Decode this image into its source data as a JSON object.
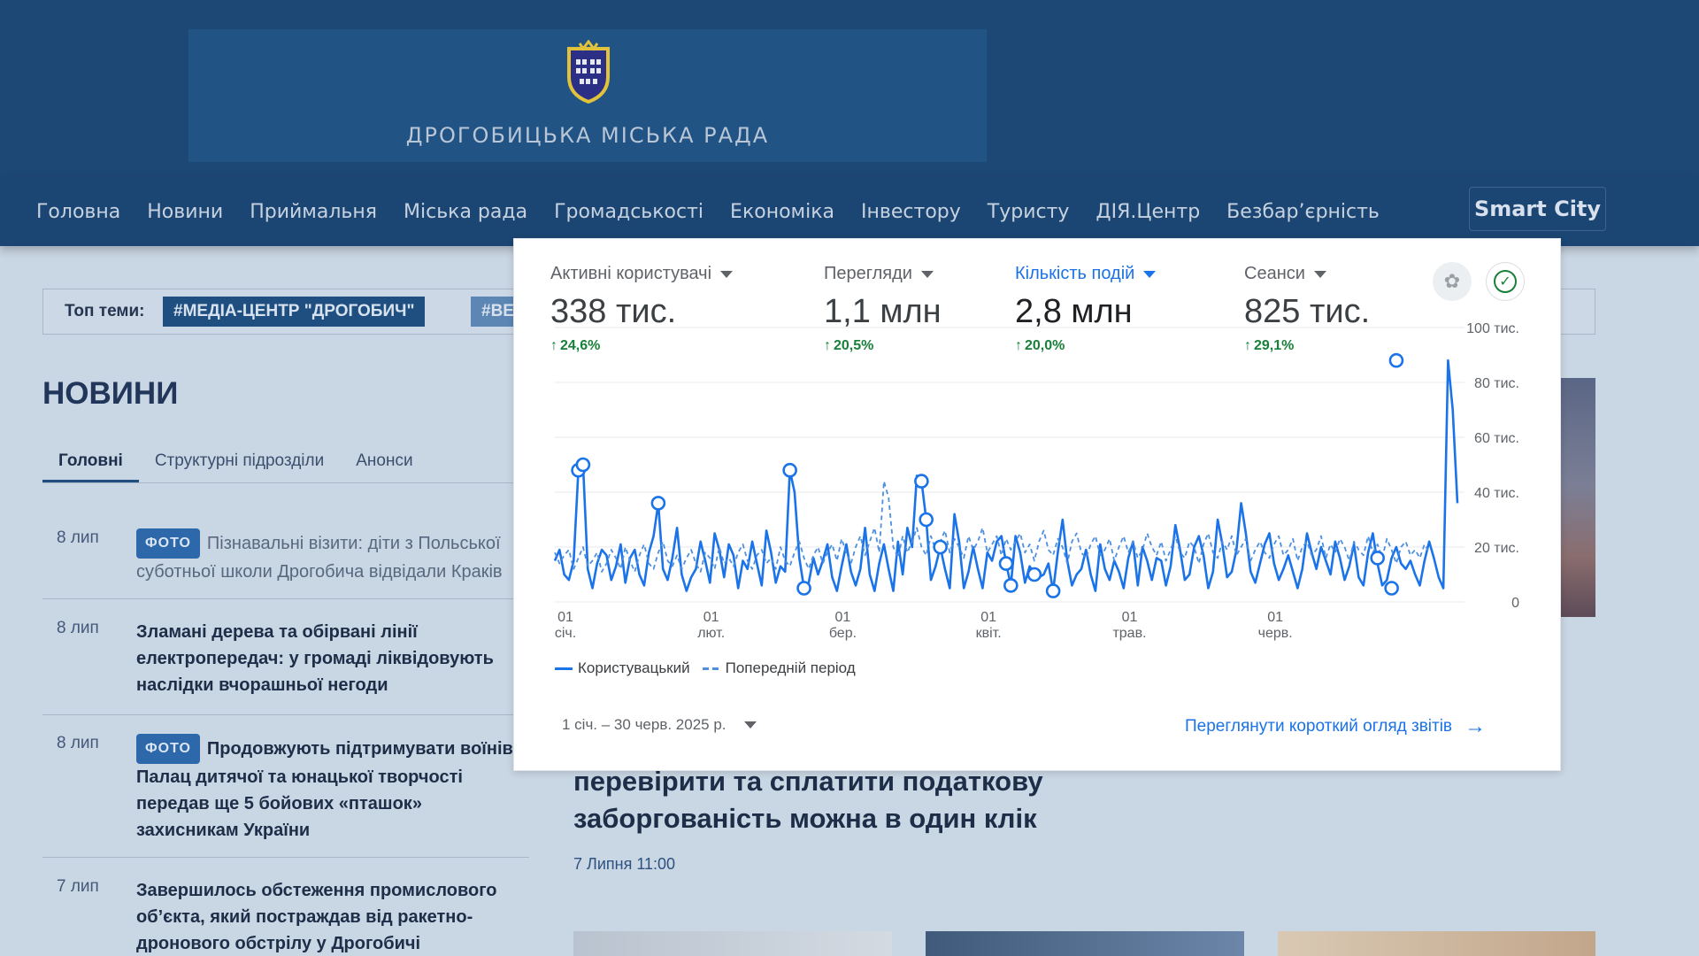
{
  "site": {
    "name": "ДРОГОБИЦЬКА МІСЬКА РАДА",
    "colors": {
      "header": "#1d4876",
      "nav": "#1b4572",
      "accent": "#1f4f80"
    }
  },
  "nav": {
    "items": [
      "Головна",
      "Новини",
      "Приймальня",
      "Міська рада",
      "Громадськості",
      "Економіка",
      "Інвестору",
      "Туристу",
      "ДІЯ.Центр",
      "Безбар’єрність"
    ],
    "smart_city": "Smart City"
  },
  "topics": {
    "label": "Топ теми:",
    "tags": [
      "#МЕДІА-ЦЕНТР \"ДРОГОБИЧ\"",
      "#ВЕ"
    ]
  },
  "news": {
    "title": "НОВИНИ",
    "tabs": [
      "Головні",
      "Структурні підрозділи",
      "Анонси"
    ],
    "badge": "ФОТО",
    "items": [
      {
        "date": "8 лип",
        "badge": "ФОТО",
        "text": "Пізнавальні візити: діти з Польської суботньої школи Дрогобича відвідали Краків"
      },
      {
        "date": "8 лип",
        "badge": "",
        "text": "Зламані дерева та обірвані лінії електропередач: у громаді ліквідовують наслідки вчорашньої негоди"
      },
      {
        "date": "8 лип",
        "badge": "ФОТО",
        "text": "Продовжують підтримувати воїнів: Палац дитячої та юнацької творчості передав ще 5 бойових «пташок» захисникам України"
      },
      {
        "date": "7 лип",
        "badge": "",
        "text": "Завершилось обстеження промислового об’єкта, який постраждав від ракетно-дронового обстрілу у Дрогобичі"
      }
    ],
    "hero": {
      "title": "перевірити та сплатити податкову заборгованість можна в один клік",
      "date": "7 Липня 11:00"
    }
  },
  "analytics": {
    "metrics": [
      {
        "label": "Активні користувачі",
        "value": "338 тис.",
        "delta": "24,6%",
        "active": false
      },
      {
        "label": "Перегляди",
        "value": "1,1 млн",
        "delta": "20,5%",
        "active": false
      },
      {
        "label": "Кількість подій",
        "value": "2,8 млн",
        "delta": "20,0%",
        "active": true
      },
      {
        "label": "Сеанси",
        "value": "825 тис.",
        "delta": "29,1%",
        "active": false
      }
    ],
    "icons": {
      "badge": "award-icon",
      "check": "check-circle-icon"
    },
    "legend": {
      "current": "Користувацький",
      "previous": "Попередній період"
    },
    "date_range": "1 січ. – 30 черв. 2025 р.",
    "report_link": "Переглянути короткий огляд звітів",
    "colors": {
      "current": "#1a73e8",
      "previous": "#4e8fe0",
      "positive": "#188038"
    }
  },
  "chart_data": {
    "type": "line",
    "x_ticks": [
      {
        "day": "01",
        "month": "січ."
      },
      {
        "day": "01",
        "month": "лют."
      },
      {
        "day": "01",
        "month": "бер."
      },
      {
        "day": "01",
        "month": "квіт."
      },
      {
        "day": "01",
        "month": "трав."
      },
      {
        "day": "01",
        "month": "черв."
      }
    ],
    "y_ticks": [
      "100 тис.",
      "80 тис.",
      "60 тис.",
      "40 тис.",
      "20 тис.",
      "0"
    ],
    "ylim": [
      0,
      100000
    ],
    "grid": true,
    "legend_position": "bottom-left",
    "series": [
      {
        "name": "Користувацький",
        "style": "solid",
        "values": [
          15000,
          19000,
          10000,
          8000,
          15000,
          48000,
          50000,
          12000,
          5000,
          14000,
          19000,
          17000,
          8000,
          13000,
          21000,
          7000,
          16000,
          19000,
          10000,
          6000,
          18000,
          24000,
          36000,
          12000,
          8000,
          16000,
          27000,
          10000,
          4000,
          9000,
          12000,
          22000,
          15000,
          7000,
          25000,
          19000,
          9000,
          21000,
          17000,
          5000,
          15000,
          12000,
          22000,
          14000,
          6000,
          26000,
          18000,
          7000,
          13000,
          11000,
          48000,
          40000,
          16000,
          5000,
          7000,
          16000,
          10000,
          15000,
          21000,
          9000,
          4000,
          13000,
          21000,
          11000,
          6000,
          12000,
          27000,
          10000,
          4000,
          14000,
          21000,
          12000,
          4000,
          22000,
          10000,
          27000,
          20000,
          46000,
          44000,
          30000,
          8000,
          13000,
          20000,
          12000,
          5000,
          32000,
          22000,
          5000,
          11000,
          20000,
          12000,
          5000,
          18000,
          15000,
          22000,
          24000,
          14000,
          6000,
          24000,
          18000,
          7000,
          13000,
          10000,
          9000,
          10000,
          14000,
          4000,
          18000,
          30000,
          15000,
          6000,
          10000,
          12000,
          19000,
          10000,
          4000,
          21000,
          12000,
          8000,
          15000,
          11000,
          5000,
          16000,
          22000,
          6000,
          20000,
          15000,
          8000,
          16000,
          15000,
          6000,
          13000,
          28000,
          19000,
          8000,
          10000,
          20000,
          24000,
          17000,
          5000,
          11000,
          30000,
          21000,
          9000,
          11000,
          19000,
          36000,
          25000,
          11000,
          7000,
          14000,
          21000,
          25000,
          14000,
          8000,
          12000,
          17000,
          11000,
          5000,
          12000,
          25000,
          18000,
          12000,
          20000,
          15000,
          10000,
          22000,
          16000,
          8000,
          13000,
          21000,
          9000,
          6000,
          18000,
          25000,
          14000,
          6000,
          8000,
          16000,
          20000,
          14000,
          12000,
          15000,
          10000,
          6000,
          15000,
          22000,
          16000,
          9000,
          5000,
          88000,
          70000,
          36000
        ]
      },
      {
        "name": "Попередній період",
        "style": "dashed",
        "values": [
          18000,
          14000,
          17000,
          19000,
          12000,
          16000,
          20000,
          13000,
          15000,
          18000,
          11000,
          14000,
          19000,
          16000,
          12000,
          20000,
          15000,
          11000,
          17000,
          21000,
          14000,
          12000,
          18000,
          22000,
          15000,
          13000,
          17000,
          12000,
          16000,
          19000,
          14000,
          11000,
          18000,
          16000,
          12000,
          20000,
          14000,
          16000,
          13000,
          18000,
          21000,
          15000,
          12000,
          17000,
          19000,
          14000,
          16000,
          12000,
          20000,
          15000,
          13000,
          18000,
          22000,
          16000,
          12000,
          17000,
          20000,
          14000,
          18000,
          21000,
          15000,
          23000,
          18000,
          14000,
          20000,
          24000,
          17000,
          22000,
          27000,
          18000,
          44000,
          38000,
          20000,
          16000,
          24000,
          18000,
          22000,
          27000,
          20000,
          17000,
          24000,
          19000,
          22000,
          26000,
          18000,
          23000,
          20000,
          16000,
          24000,
          19000,
          22000,
          27000,
          18000,
          21000,
          24000,
          17000,
          23000,
          19000,
          22000,
          25000,
          18000,
          21000,
          15000,
          22000,
          26000,
          19000,
          17000,
          23000,
          20000,
          14000,
          22000,
          25000,
          18000,
          16000,
          21000,
          24000,
          17000,
          19000,
          23000,
          15000,
          20000,
          24000,
          18000,
          22000,
          16000,
          19000,
          25000,
          20000,
          17000,
          22000,
          15000,
          19000,
          24000,
          18000,
          16000,
          22000,
          20000,
          14000,
          21000,
          25000,
          18000,
          16000,
          22000,
          19000,
          24000,
          17000,
          20000,
          23000,
          15000,
          19000,
          22000,
          18000,
          16000,
          21000,
          24000,
          17000,
          19000,
          23000,
          15000,
          20000,
          22000,
          17000,
          19000,
          24000,
          16000,
          21000,
          18000,
          23000,
          20000,
          15000,
          22000,
          19000,
          17000,
          24000,
          18000,
          21000,
          16000,
          23000,
          19000,
          14000,
          20000,
          22000,
          17000,
          19000,
          16000,
          21000,
          18000
        ]
      }
    ],
    "highlighted_points": [
      {
        "series": "Користувацький",
        "index": 5,
        "value": 48000
      },
      {
        "series": "Користувацький",
        "index": 6,
        "value": 50000
      },
      {
        "series": "Користувацький",
        "index": 22,
        "value": 36000
      },
      {
        "series": "Користувацький",
        "index": 50,
        "value": 48000
      },
      {
        "series": "Користувацький",
        "index": 53,
        "value": 5000
      },
      {
        "series": "Користувацький",
        "index": 78,
        "value": 44000
      },
      {
        "series": "Користувацький",
        "index": 79,
        "value": 30000
      },
      {
        "series": "Користувацький",
        "index": 82,
        "value": 20000
      },
      {
        "series": "Користувацький",
        "index": 96,
        "value": 14000
      },
      {
        "series": "Користувацький",
        "index": 97,
        "value": 6000
      },
      {
        "series": "Користувацький",
        "index": 102,
        "value": 10000
      },
      {
        "series": "Користувацький",
        "index": 106,
        "value": 4000
      },
      {
        "series": "Користувацький",
        "index": 175,
        "value": 16000
      },
      {
        "series": "Користувацький",
        "index": 178,
        "value": 5000
      },
      {
        "series": "Користувацький",
        "index": 179,
        "value": 88000
      }
    ]
  }
}
